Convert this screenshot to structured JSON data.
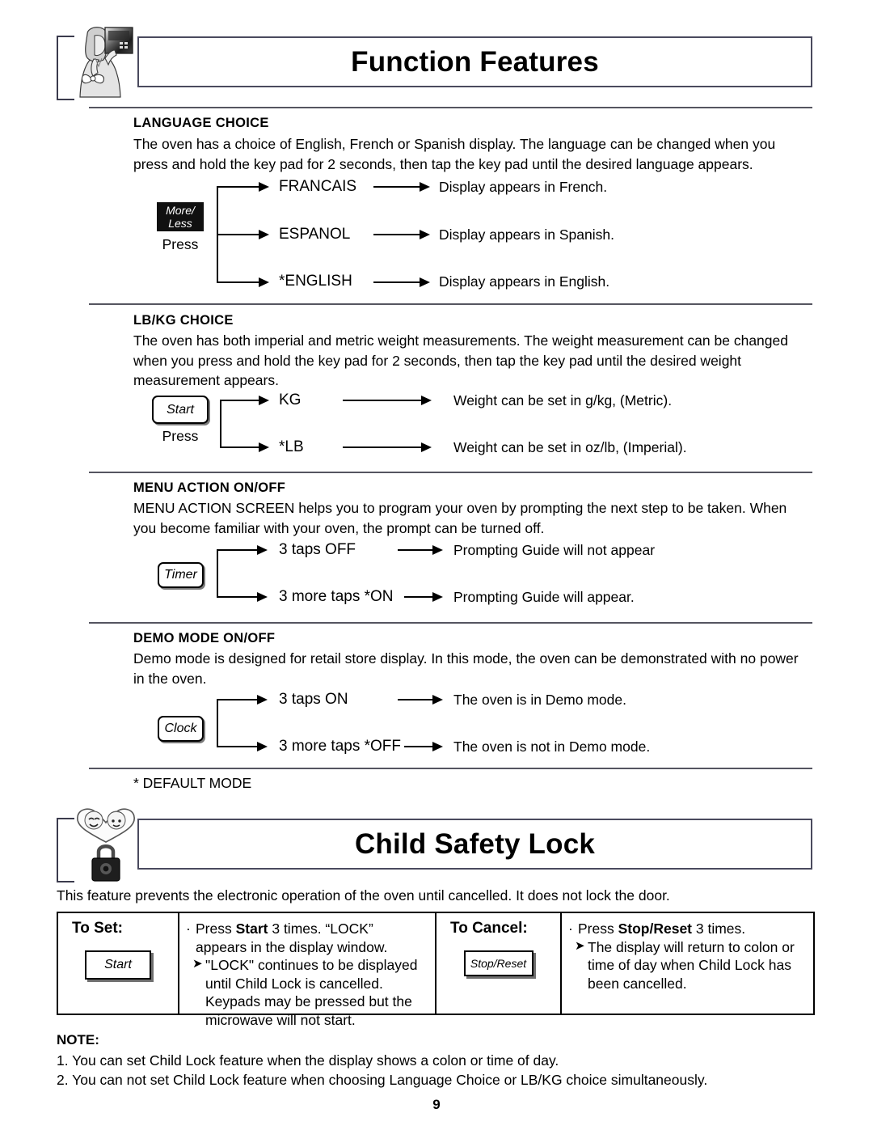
{
  "page": {
    "number": "9"
  },
  "header": {
    "title": "Function Features",
    "art_icon": "woman-holding-control-panel-illustration"
  },
  "sections": [
    {
      "id": "language-choice",
      "heading": "LANGUAGE CHOICE",
      "body": "The oven has a choice of English, French or Spanish display. The language can be changed when you press and hold the key pad for 2 seconds, then tap the key pad until the desired language appears.",
      "keypad": {
        "label": "More/\nLess",
        "line1": "More/",
        "line2": "Less",
        "style": "dark"
      },
      "press_label": "Press",
      "rows": [
        {
          "option": "FRANCAIS",
          "result": "Display appears in French."
        },
        {
          "option": "ESPANOL",
          "result": "Display appears in Spanish."
        },
        {
          "option": "*ENGLISH",
          "result": "Display appears in English."
        }
      ]
    },
    {
      "id": "lb-kg-choice",
      "heading": "LB/KG CHOICE",
      "body": "The oven has both imperial and metric weight measurements. The weight measurement can be changed when you press and hold the key pad for 2 seconds, then tap the key pad until the desired weight measurement appears.",
      "keypad": {
        "label": "Start",
        "style": "light"
      },
      "press_label": "Press",
      "rows": [
        {
          "option": "KG",
          "result": "Weight can be set in g/kg, (Metric)."
        },
        {
          "option": "*LB",
          "result": "Weight can be set in oz/lb, (Imperial)."
        }
      ]
    },
    {
      "id": "menu-action-on-off",
      "heading": "MENU ACTION ON/OFF",
      "body": "MENU ACTION SCREEN helps you to program your oven by prompting the next step to be taken. When you become familiar with your oven, the prompt can be turned off.",
      "keypad": {
        "label": "Timer",
        "style": "light"
      },
      "rows": [
        {
          "option": "3 taps OFF",
          "result": "Prompting Guide will not appear"
        },
        {
          "option": "3 more taps *ON",
          "result": "Prompting Guide will appear."
        }
      ]
    },
    {
      "id": "demo-mode-on-off",
      "heading": "DEMO MODE ON/OFF",
      "body": "Demo mode is designed for retail store display. In this mode, the oven can be demonstrated with no power in the oven.",
      "keypad": {
        "label": "Clock",
        "style": "light"
      },
      "rows": [
        {
          "option": "3 taps ON",
          "result": "The oven is in Demo mode."
        },
        {
          "option": "3 more taps *OFF",
          "result": "The oven is not in Demo mode."
        }
      ]
    }
  ],
  "default_mode_note": "* DEFAULT MODE",
  "child_lock": {
    "title": "Child Safety Lock",
    "art_icon": "heart-children-padlock-illustration",
    "intro": "This feature prevents the electronic operation of the oven until cancelled. It does not lock the door.",
    "to_set": {
      "title": "To Set:",
      "button": "Start",
      "bullet": {
        "pre": "Press ",
        "bold": "Start",
        "post": " 3 times. “LOCK”"
      },
      "bullet_cont": "appears in the display window.",
      "sub": "\"LOCK\" continues to be displayed",
      "sub_cont_1": "until Child Lock is cancelled.",
      "sub_cont_2": "Keypads may be pressed but the",
      "sub_cont_3": "microwave will not start."
    },
    "to_cancel": {
      "title": "To Cancel:",
      "button": "Stop/Reset",
      "bullet": {
        "pre": "Press ",
        "bold": "Stop/Reset",
        "post": " 3 times."
      },
      "sub": "The display will return to colon or",
      "sub_cont_1": "time of day when Child Lock has",
      "sub_cont_2": "been cancelled."
    }
  },
  "note": {
    "heading": "NOTE:",
    "items": [
      "1. You can set Child Lock feature when the display shows a colon or time of day.",
      "2. You can not set Child Lock feature when choosing Language Choice or LB/KG choice simultaneously."
    ]
  }
}
